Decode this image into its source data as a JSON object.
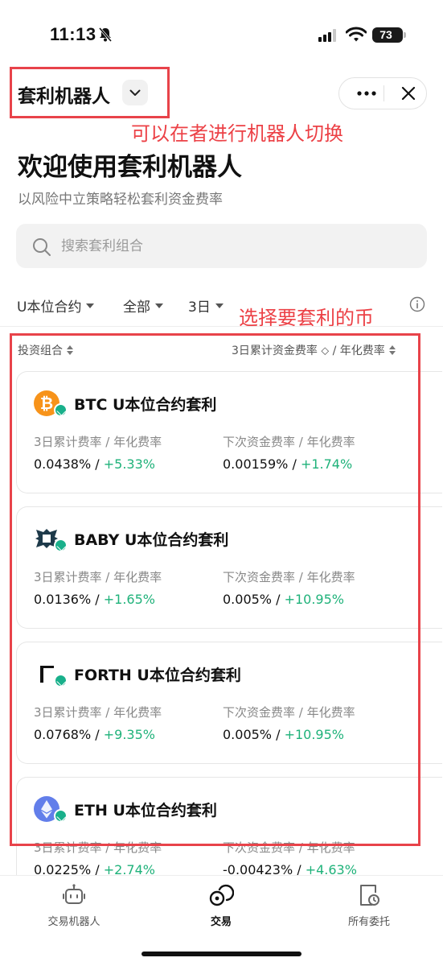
{
  "status_bar": {
    "time": "11:13",
    "battery": "73"
  },
  "header": {
    "title": "套利机器人"
  },
  "annotations": {
    "switch_robot": "可以在者进行机器人切换",
    "select_coin": "选择要套利的币"
  },
  "intro": {
    "title": "欢迎使用套利机器人",
    "subtitle": "以风险中立策略轻松套利资金费率"
  },
  "search": {
    "placeholder": "搜索套利组合"
  },
  "filters": {
    "contract": "U本位合约",
    "scope": "全部",
    "period": "3日"
  },
  "columns": {
    "portfolio": "投资组合",
    "rate": "3日累计资金费率 ⬦ / 年化费率"
  },
  "cards": [
    {
      "coin": "BTC",
      "name": "BTC U本位合约套利",
      "label_left": "3日累计费率 / 年化费率",
      "label_right": "下次资金费率 / 年化费率",
      "val_left": "0.0438% / ",
      "up_left": "+5.33%",
      "val_right": "0.00159% / ",
      "up_right": "+1.74%"
    },
    {
      "coin": "BABY",
      "name": "BABY U本位合约套利",
      "label_left": "3日累计费率 / 年化费率",
      "label_right": "下次资金费率 / 年化费率",
      "val_left": "0.0136% / ",
      "up_left": "+1.65%",
      "val_right": "0.005% / ",
      "up_right": "+10.95%"
    },
    {
      "coin": "FORTH",
      "name": "FORTH U本位合约套利",
      "label_left": "3日累计费率 / 年化费率",
      "label_right": "下次资金费率 / 年化费率",
      "val_left": "0.0768% / ",
      "up_left": "+9.35%",
      "val_right": "0.005% / ",
      "up_right": "+10.95%"
    },
    {
      "coin": "ETH",
      "name": "ETH U本位合约套利",
      "label_left": "3日累计费率 / 年化费率",
      "label_right": "下次资金费率 / 年化费率",
      "val_left": "0.0225% / ",
      "up_left": "+2.74%",
      "val_right": "-0.00423% / ",
      "up_right": "+4.63%"
    }
  ],
  "tabs": [
    {
      "label": "交易机器人"
    },
    {
      "label": "交易"
    },
    {
      "label": "所有委托"
    }
  ],
  "colors": {
    "accent_up": "#1fb27a",
    "annotation": "#e8434a",
    "btc": "#f7931a",
    "eth": "#627eea"
  }
}
